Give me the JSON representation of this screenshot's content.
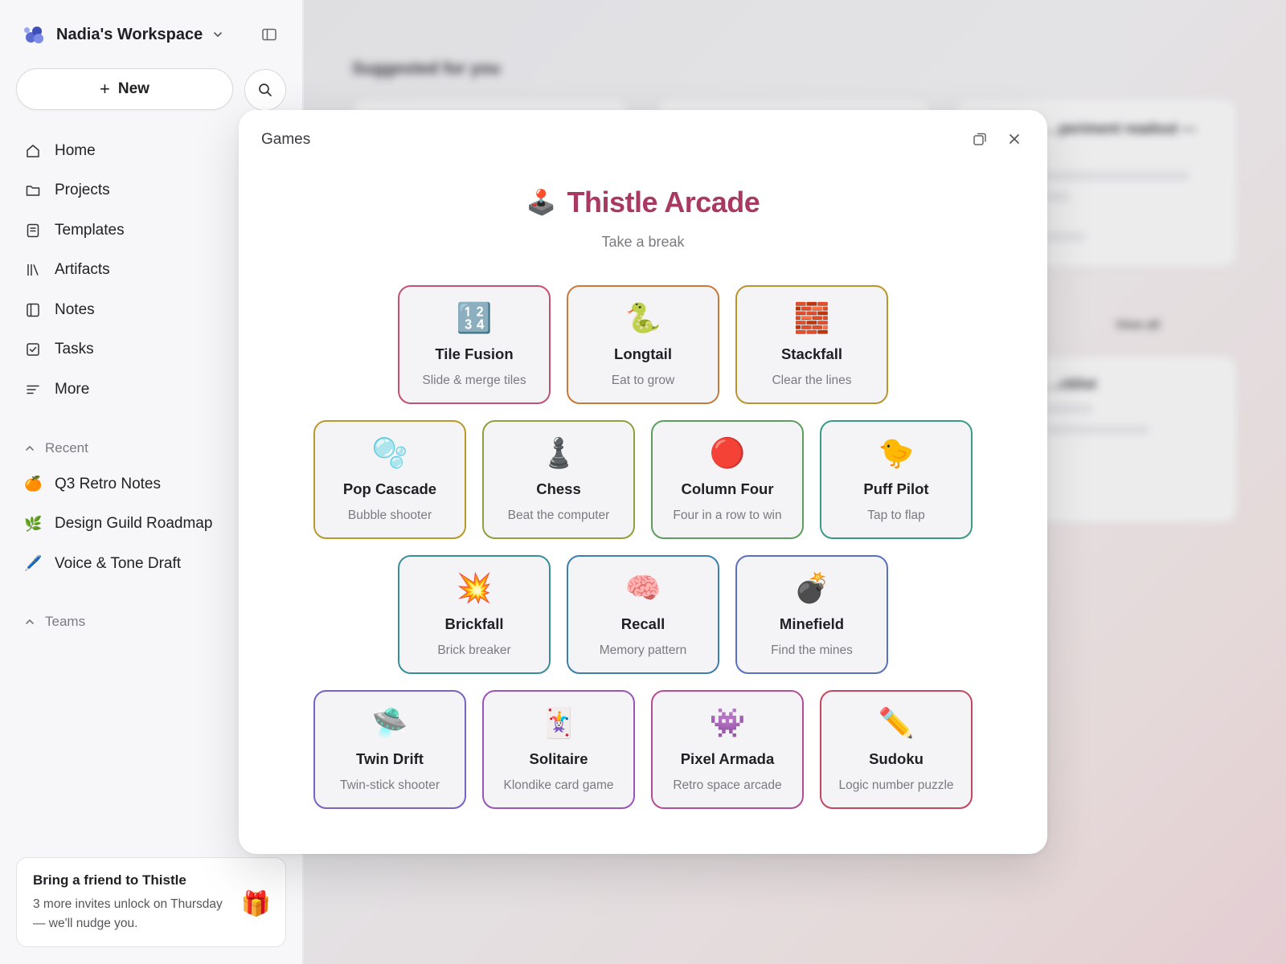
{
  "workspace": {
    "name": "Nadia's Workspace"
  },
  "sidebar": {
    "new_label": "New",
    "nav": [
      {
        "label": "Home",
        "icon": "home-icon"
      },
      {
        "label": "Projects",
        "icon": "folder-icon"
      },
      {
        "label": "Templates",
        "icon": "template-icon"
      },
      {
        "label": "Artifacts",
        "icon": "library-icon"
      },
      {
        "label": "Notes",
        "icon": "notebook-icon"
      },
      {
        "label": "Tasks",
        "icon": "checkbox-icon"
      },
      {
        "label": "More",
        "icon": "more-lines-icon"
      }
    ],
    "recent_label": "Recent",
    "recent": [
      {
        "emoji": "🍊",
        "label": "Q3 Retro Notes"
      },
      {
        "emoji": "🌿",
        "label": "Design Guild Roadmap"
      },
      {
        "emoji": "🖊️",
        "label": "Voice & Tone Draft"
      }
    ],
    "teams_label": "Teams",
    "promo": {
      "title": "Bring a friend to Thistle",
      "body": "3 more invites unlock on Thursday — we'll nudge you.",
      "emoji": "🎁"
    }
  },
  "background": {
    "suggested_title": "Suggested for you",
    "card_title": "…periment readout —",
    "view_all": "View all",
    "card2_title": "…cklist"
  },
  "modal": {
    "label": "Games",
    "arcade_emoji": "🕹️",
    "arcade_title": "Thistle Arcade",
    "subtitle": "Take a break",
    "games": [
      {
        "emoji": "🔢",
        "name": "Tile Fusion",
        "desc": "Slide & merge tiles",
        "color": "#c2526f"
      },
      {
        "emoji": "🐍",
        "name": "Longtail",
        "desc": "Eat to grow",
        "color": "#c77a3c"
      },
      {
        "emoji": "🧱",
        "name": "Stackfall",
        "desc": "Clear the lines",
        "color": "#b8952e"
      },
      {
        "emoji": "🫧",
        "name": "Pop Cascade",
        "desc": "Bubble shooter",
        "color": "#b89a2a"
      },
      {
        "emoji": "♟️",
        "name": "Chess",
        "desc": "Beat the computer",
        "color": "#8fa03e"
      },
      {
        "emoji": "🔴",
        "name": "Column Four",
        "desc": "Four in a row to win",
        "color": "#5c9e5e"
      },
      {
        "emoji": "🐤",
        "name": "Puff Pilot",
        "desc": "Tap to flap",
        "color": "#3b9a86"
      },
      {
        "emoji": "💥",
        "name": "Brickfall",
        "desc": "Brick breaker",
        "color": "#3a8d99"
      },
      {
        "emoji": "🧠",
        "name": "Recall",
        "desc": "Memory pattern",
        "color": "#3a7fae"
      },
      {
        "emoji": "💣",
        "name": "Minefield",
        "desc": "Find the mines",
        "color": "#5a6fc0"
      },
      {
        "emoji": "🛸",
        "name": "Twin Drift",
        "desc": "Twin-stick shooter",
        "color": "#7a62c4"
      },
      {
        "emoji": "🃏",
        "name": "Solitaire",
        "desc": "Klondike card game",
        "color": "#9a55b8"
      },
      {
        "emoji": "👾",
        "name": "Pixel Armada",
        "desc": "Retro space arcade",
        "color": "#b24e96"
      },
      {
        "emoji": "✏️",
        "name": "Sudoku",
        "desc": "Logic number puzzle",
        "color": "#c2485f"
      }
    ]
  },
  "colors": {
    "accent": "#a83a62",
    "sidebar_bg": "#f7f7f9"
  }
}
